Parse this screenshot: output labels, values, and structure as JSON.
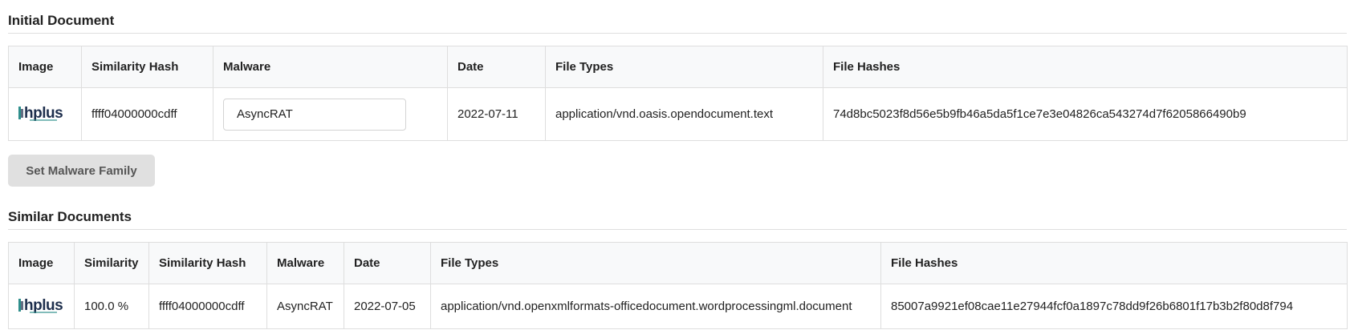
{
  "initial": {
    "title": "Initial Document",
    "headers": [
      "Image",
      "Similarity Hash",
      "Malware",
      "Date",
      "File Types",
      "File Hashes"
    ],
    "row": {
      "logo_text": "hplus",
      "similarity_hash": "ffff04000000cdff",
      "malware_value": "AsyncRAT",
      "date": "2022-07-11",
      "file_types": "application/vnd.oasis.opendocument.text",
      "file_hashes": "74d8bc5023f8d56e5b9fb46a5da5f1ce7e3e04826ca543274d7f6205866490b9"
    }
  },
  "set_button_label": "Set Malware Family",
  "similar": {
    "title": "Similar Documents",
    "headers": [
      "Image",
      "Similarity",
      "Similarity Hash",
      "Malware",
      "Date",
      "File Types",
      "File Hashes"
    ],
    "rows": [
      {
        "logo_text": "hplus",
        "similarity": "100.0 %",
        "similarity_hash": "ffff04000000cdff",
        "malware": "AsyncRAT",
        "date": "2022-07-05",
        "file_types": "application/vnd.openxmlformats-officedocument.wordprocessingml.document",
        "file_hashes": "85007a9921ef08cae11e27944fcf0a1897c78dd9f26b6801f17b3b2f80d8f794"
      }
    ]
  },
  "colors": {
    "logo_dark": "#1e2f4d",
    "logo_teal": "#2f8f8c"
  }
}
